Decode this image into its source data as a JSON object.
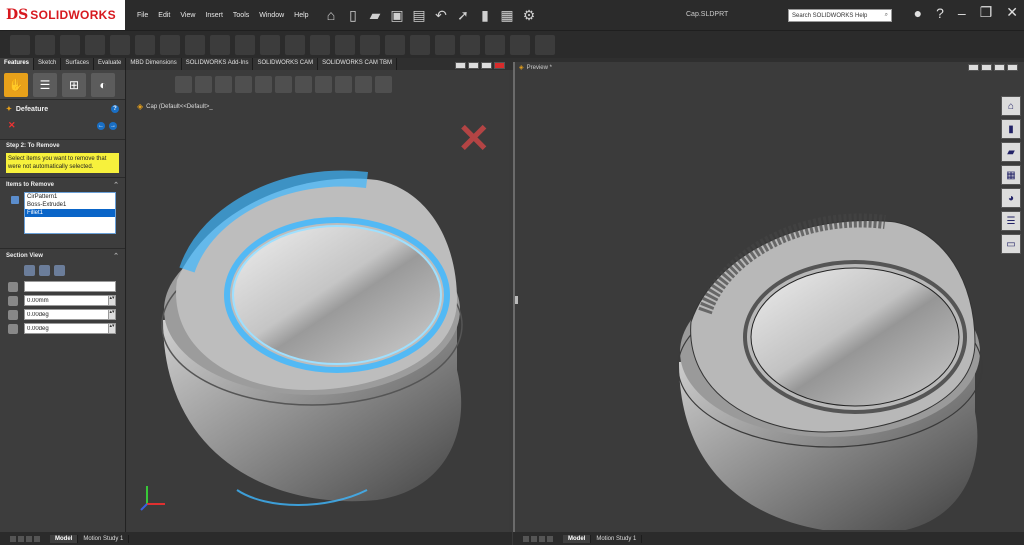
{
  "app": {
    "brand_ds": "DS",
    "brand_name": "SOLIDWORKS"
  },
  "menu": [
    "File",
    "Edit",
    "View",
    "Insert",
    "Tools",
    "Window",
    "Help"
  ],
  "document_title": "Cap.SLDPRT",
  "search": {
    "placeholder": "Search SOLIDWORKS Help"
  },
  "tabs": [
    "Features",
    "Sketch",
    "Surfaces",
    "Evaluate",
    "MBD Dimensions",
    "SOLIDWORKS Add-Ins",
    "SOLIDWORKS CAM",
    "SOLIDWORKS CAM TBM"
  ],
  "active_tab": "Features",
  "property_manager": {
    "title": "Defeature",
    "step_heading": "Step 2: To Remove",
    "step_note": "Select items you want to remove that were not automatically selected.",
    "items_heading": "Items to Remove",
    "items": [
      "CirPattern1",
      "Boss-Extrude1",
      "Fillet1"
    ],
    "selected_item": "Fillet1",
    "section_view_heading": "Section View",
    "section_fields": [
      "",
      "0.00mm",
      "0.00deg",
      "0.00deg"
    ]
  },
  "viewport_left": {
    "tree_label": "Cap (Default<<Default>_"
  },
  "viewport_right": {
    "label": "Preview *"
  },
  "bottom_tabs": [
    "Model",
    "Motion Study 1"
  ],
  "colors": {
    "accent": "#e8a11a",
    "brand_red": "#d7191f",
    "glow": "#3fb8ff",
    "selection": "#0a65c8",
    "note_yellow": "#f7f13c"
  }
}
